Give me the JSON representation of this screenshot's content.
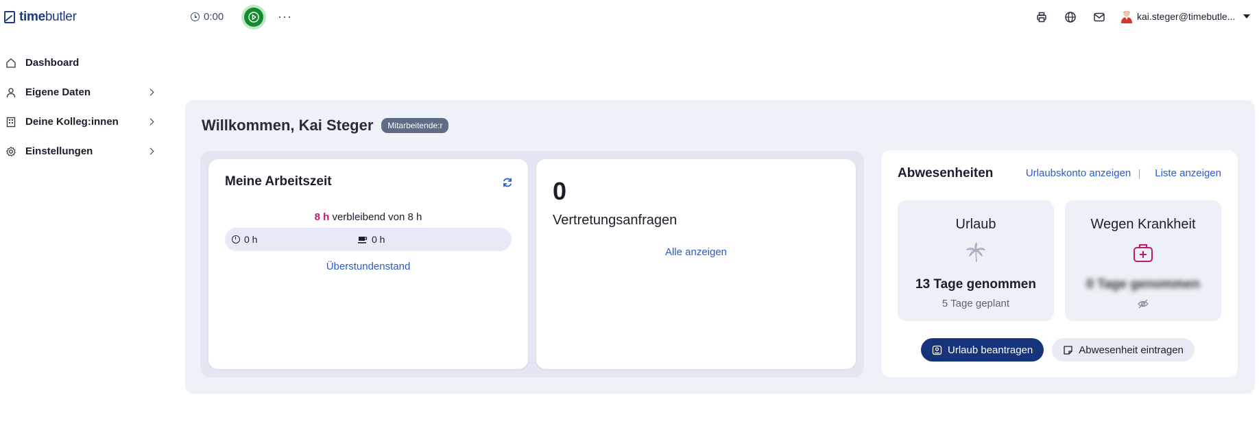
{
  "app": {
    "brand_bold": "time",
    "brand_rest": "butler"
  },
  "topbar": {
    "timer_value": "0:00",
    "play_icon": "play-icon",
    "more_label": "···",
    "user_email": "kai.steger@timebutle..."
  },
  "sidebar": {
    "items": [
      {
        "label": "Dashboard",
        "icon": "home-icon",
        "has_chevron": false
      },
      {
        "label": "Eigene Daten",
        "icon": "user-icon",
        "has_chevron": true
      },
      {
        "label": "Deine Kolleg:innen",
        "icon": "building-icon",
        "has_chevron": true
      },
      {
        "label": "Einstellungen",
        "icon": "gear-icon",
        "has_chevron": true
      }
    ]
  },
  "welcome": {
    "title": "Willkommen, Kai Steger",
    "role": "Mitarbeitende:r"
  },
  "worktime": {
    "title": "Meine Arbeitszeit",
    "remaining_value": "8 h",
    "remaining_text": " verbleibend von 8 h",
    "worked": "0 h",
    "break": "0 h",
    "overtime_link": "Überstundenstand"
  },
  "substitutes": {
    "count": "0",
    "label": "Vertretungsanfragen",
    "link": "Alle anzeigen"
  },
  "absences": {
    "title": "Abwesenheiten",
    "link_account": "Urlaubskonto anzeigen",
    "link_list": "Liste anzeigen",
    "vacation": {
      "title": "Urlaub",
      "taken": "13 Tage genommen",
      "planned": "5 Tage geplant"
    },
    "sickness": {
      "title": "Wegen Krankheit",
      "taken": "0 Tage genommen"
    },
    "btn_request": "Urlaub beantragen",
    "btn_enter": "Abwesenheit eintragen"
  },
  "colors": {
    "accent": "#16347c",
    "link": "#2a5bc8",
    "highlight": "#c0186d",
    "play": "#138a2e",
    "panel_bg": "#eff1f9"
  }
}
